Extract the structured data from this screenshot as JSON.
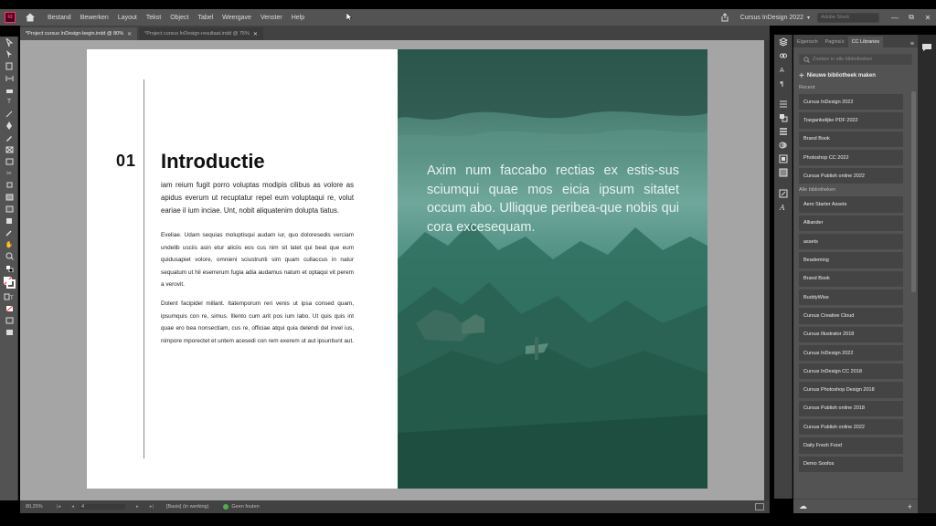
{
  "app": {
    "logo": "Id",
    "menu": [
      "Bestand",
      "Bewerken",
      "Layout",
      "Tekst",
      "Object",
      "Tabel",
      "Weergave",
      "Venster",
      "Help"
    ],
    "workspace": "Cursus InDesign 2022",
    "stock_placeholder": "Adobe Stock",
    "window_buttons": [
      "—",
      "⧉",
      "✕"
    ]
  },
  "tabs": [
    {
      "label": "*Project cursus InDesign-begin.indd @ 80%",
      "active": true
    },
    {
      "label": "*Project cursus InDesign-resultaat.indd @ 75%",
      "active": false
    }
  ],
  "document": {
    "chapter_number": "01",
    "chapter_title": "Introductie",
    "paragraph1": "iam reium fugit porro voluptas modipis cilibus as volore as apidus everum ut recuptatur repel eum voluptaqui re, volut eariae il ium inciae. Unt, nobit aliquatenim dolupta tiatus.",
    "paragraph2": "Eveliae. Udam sequias moluptisqui audam iur, quo doloresedis verciam undelib usciis asin etur aliciis eos cus nim sit latet qui beat que eum quidusapiet volore, omnieni sciustrunti sim quam cullaccus in natur sequatum ut hil eserrerum fugia adia audamus natum et optaqui vit perem a verovit.",
    "paragraph3": "Dolent facipidel millant. Itatemporum reri venis ut ipsa consed quam, ipsumquis con re, simus. Illento cum arit pos ium labo. Ut quis quis int quae ero bea nonsectiam, cus re, officiae atqui quia delendi del invel ius, nimpore mporectet et untem acesedi con rem exerem ut aut ipsuntiunt aut.",
    "quote": "Axim num faccabo rectias ex estis-sus sciumqui quae mos eicia ipsum sitatet occum abo. Ulliqque peribea-que nobis qui cora excesequam."
  },
  "status": {
    "zoom": "80,25%",
    "page": "4",
    "master": "[Basis] (in werking)",
    "preflight": "Geen fouten"
  },
  "panel": {
    "tabs": [
      "Eigensch",
      "Pagina's",
      "CC Libraries"
    ],
    "active_tab": "CC Libraries",
    "search_placeholder": "Zoeken in alle bibliotheken",
    "new_library": "Nieuwe bibliotheek maken",
    "recent_label": "Recent",
    "recent": [
      "Cursus InDesign 2022",
      "Toegankelijke PDF 2022",
      "Brand Book",
      "Photoshop CC 2022",
      "Cursus Publish online 2022"
    ],
    "all_label": "Alle bibliotheken",
    "all": [
      "Aero Starter Assets",
      "Alliander",
      "assets",
      "Beademing",
      "Brand Book",
      "BuddyWise",
      "Cursus Creative Cloud",
      "Cursus Illustrator 2018",
      "Cursus InDesign 2022",
      "Cursus InDesign CC 2018",
      "Cursus Photoshop Design 2018",
      "Cursus Publish online 2018",
      "Cursus Publish online 2022",
      "Daily Fresh Food",
      "Demo Soofos"
    ]
  },
  "colors": {
    "accent": "#ff3366",
    "photo_teal": "#3f8a7c"
  }
}
